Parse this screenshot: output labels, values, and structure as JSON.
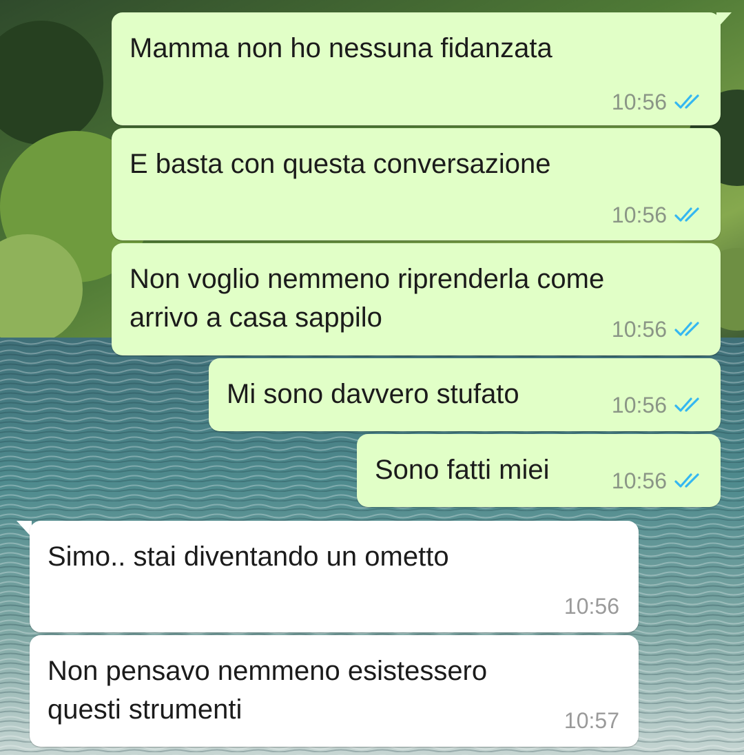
{
  "colors": {
    "outgoing_bubble": "#e1ffc7",
    "incoming_bubble": "#ffffff",
    "read_ticks": "#34b7f1",
    "timestamp": "#8a9586"
  },
  "icons": {
    "read_receipt": "double-check-read-icon"
  },
  "messages": [
    {
      "direction": "outgoing",
      "text": "Mamma non ho nessuna fidanzata",
      "time": "10:56",
      "status": "read"
    },
    {
      "direction": "outgoing",
      "text": "E basta con questa conversazione",
      "time": "10:56",
      "status": "read"
    },
    {
      "direction": "outgoing",
      "text": "Non voglio nemmeno riprenderla come\narrivo a casa sappilo",
      "time": "10:56",
      "status": "read"
    },
    {
      "direction": "outgoing",
      "text": "Mi sono davvero stufato",
      "time": "10:56",
      "status": "read"
    },
    {
      "direction": "outgoing",
      "text": "Sono fatti miei",
      "time": "10:56",
      "status": "read"
    },
    {
      "direction": "incoming",
      "text": "Simo.. stai diventando un ometto",
      "time": "10:56"
    },
    {
      "direction": "incoming",
      "text": "Non pensavo nemmeno esistessero\nquesti strumenti",
      "time": "10:57"
    }
  ]
}
